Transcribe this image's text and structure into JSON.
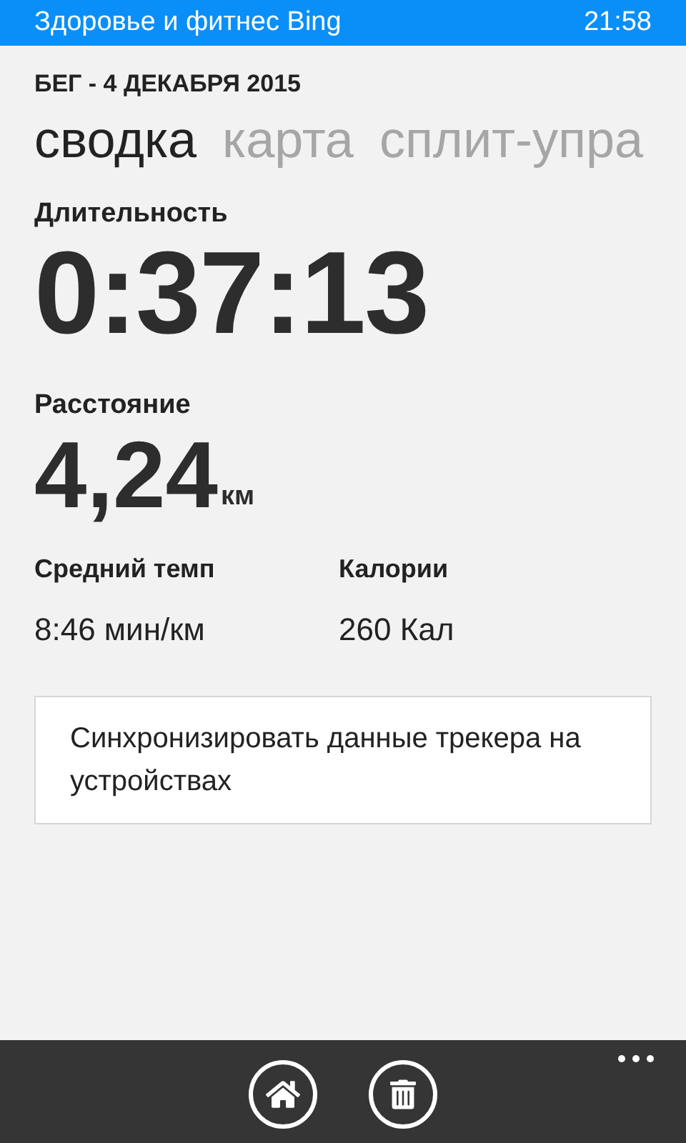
{
  "status_bar": {
    "app_title": "Здоровье и фитнес Bing",
    "time": "21:58"
  },
  "header": "БЕГ - 4 ДЕКАБРЯ 2015",
  "tabs": [
    {
      "label": "сводка",
      "selected": true
    },
    {
      "label": "карта",
      "selected": false
    },
    {
      "label": "сплит-упра",
      "selected": false
    }
  ],
  "duration": {
    "label": "Длительность",
    "value": "0:37:13"
  },
  "distance": {
    "label": "Расстояние",
    "value": "4,24",
    "unit": "км"
  },
  "stats": [
    {
      "label": "Средний темп",
      "value": "8:46 мин/км"
    },
    {
      "label": "Калории",
      "value": "260 Кал"
    }
  ],
  "sync_button": "Синхронизировать данные трекера на устройствах",
  "app_bar": {
    "buttons": [
      {
        "kind": "home"
      },
      {
        "kind": "delete"
      }
    ]
  }
}
